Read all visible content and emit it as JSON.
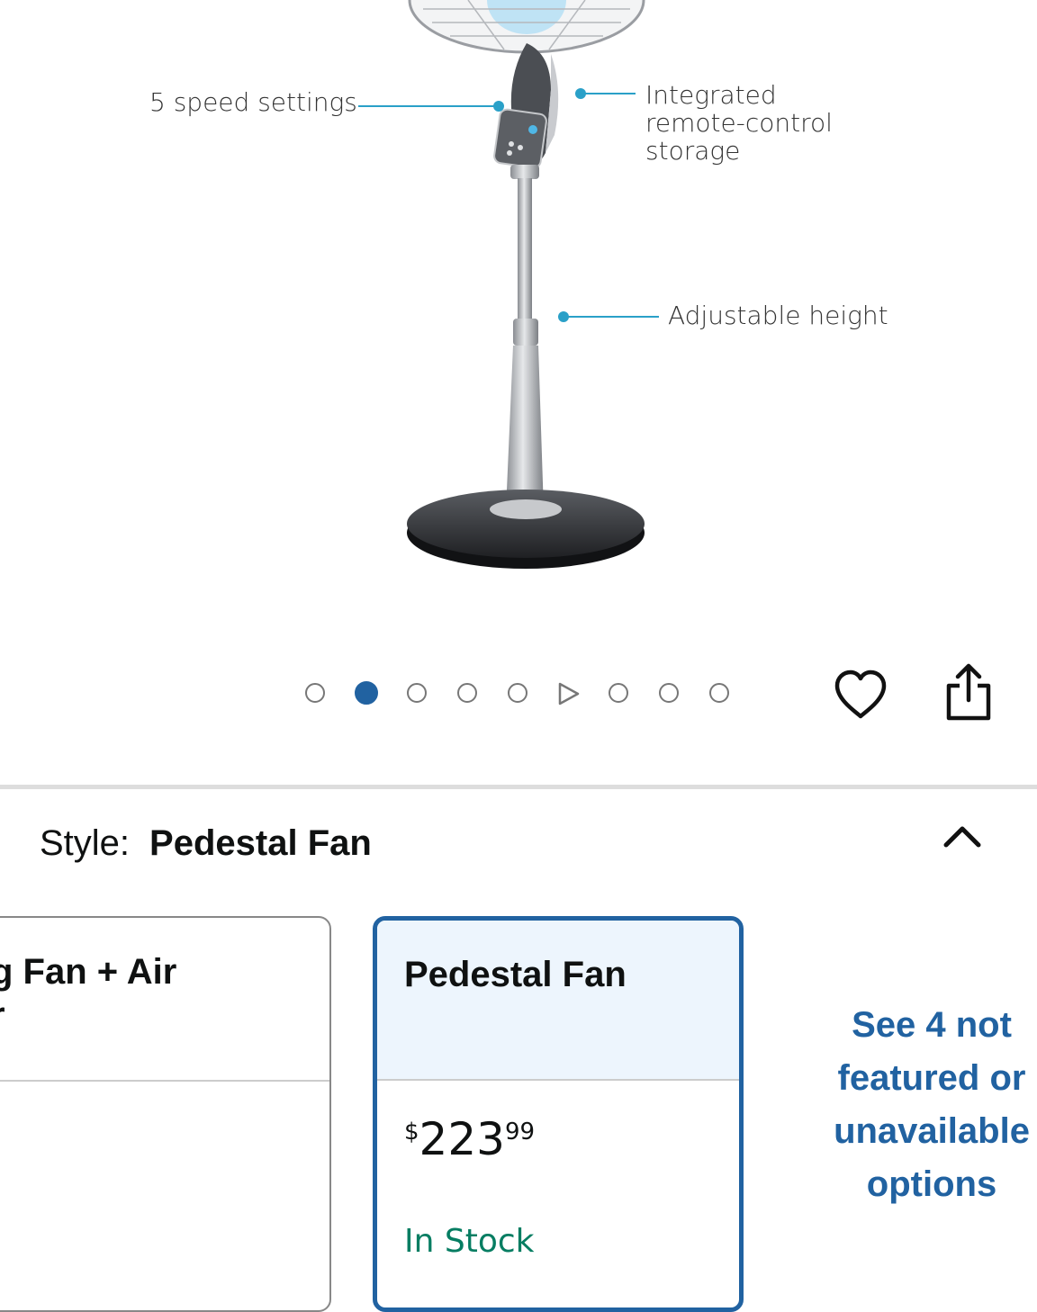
{
  "gallery": {
    "callouts": {
      "speed": "5 speed settings",
      "remote_line1": "Integrated",
      "remote_line2": "remote-control",
      "remote_line3": "storage",
      "height": "Adjustable height"
    },
    "image_count": 9,
    "active_index": 2,
    "video_index": 6
  },
  "style": {
    "label": "Style:",
    "selected": "Pedestal Fan"
  },
  "options": {
    "left_card": {
      "title_line1": "g Fan + Air",
      "title_line2": "r"
    },
    "selected_card": {
      "title": "Pedestal Fan",
      "price_currency": "$",
      "price_whole": "223",
      "price_fraction": "99",
      "availability": "In Stock"
    },
    "see_more": "See 4 not featured or unavailable options"
  },
  "colors": {
    "accent": "#2162a1",
    "in_stock": "#067d62",
    "card_highlight": "#edf5fd"
  },
  "icons": [
    "heart-icon",
    "share-icon",
    "chevron-up-icon",
    "play-icon"
  ]
}
